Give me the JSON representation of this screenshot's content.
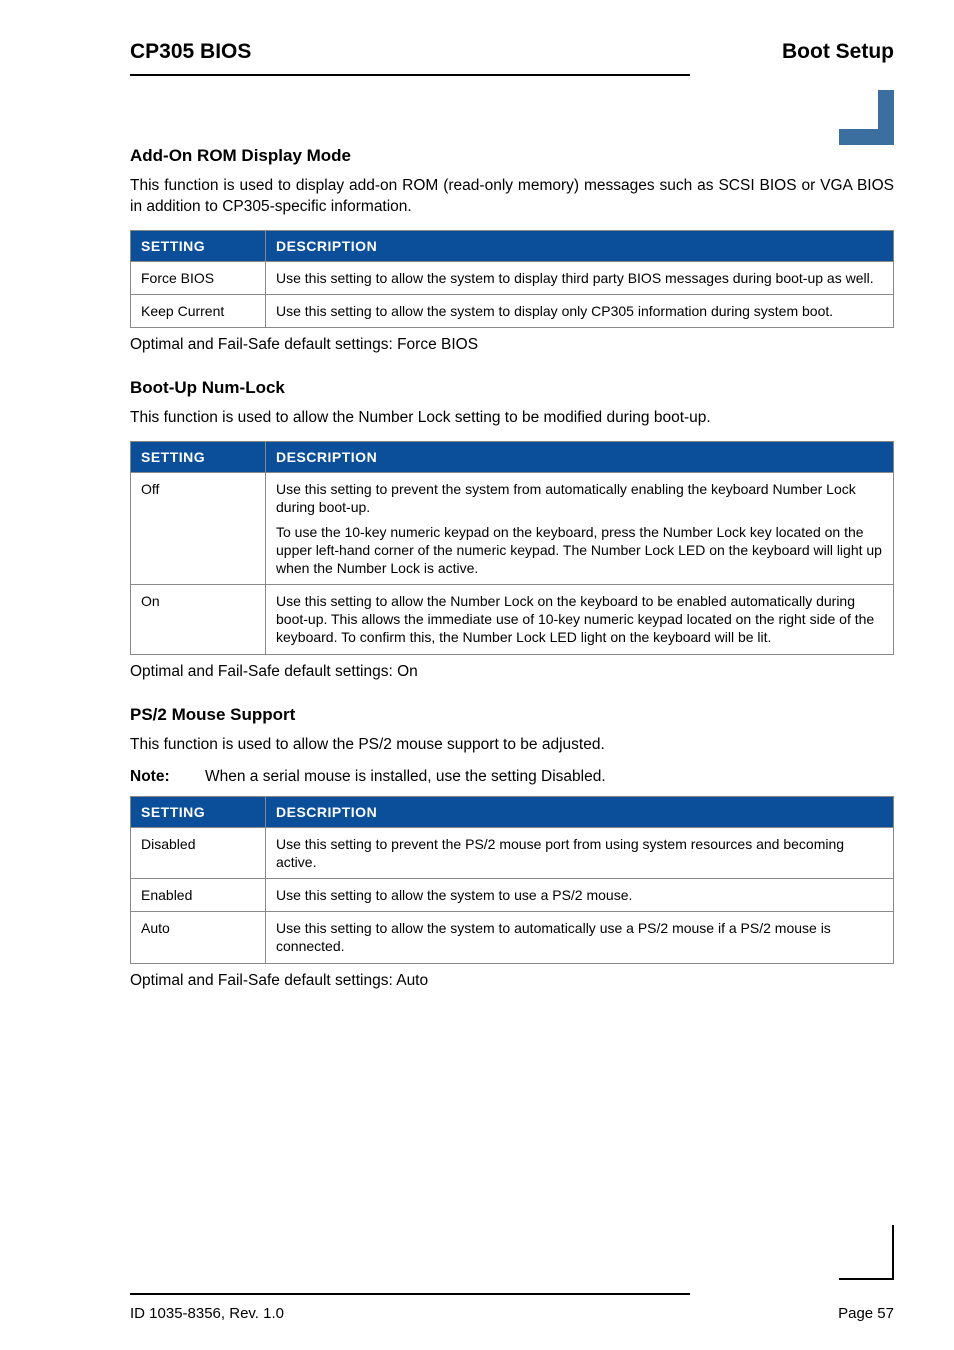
{
  "header": {
    "left": "CP305 BIOS",
    "right": "Boot Setup"
  },
  "sections": [
    {
      "title": "Add-On ROM Display Mode",
      "intro": "This function is used to display add-on ROM (read-only memory) messages such as SCSI BIOS or VGA BIOS in addition to CP305-specific information.",
      "th1": "SETTING",
      "th2": "DESCRIPTION",
      "rows": [
        {
          "setting": "Force BIOS",
          "desc": [
            "Use this setting to allow the system to display third party BIOS messages during boot-up as well."
          ]
        },
        {
          "setting": "Keep Current",
          "desc": [
            "Use this setting to allow the system to display only CP305 information during system boot."
          ]
        }
      ],
      "default": "Optimal and Fail-Safe default settings: Force BIOS"
    },
    {
      "title": "Boot-Up Num-Lock",
      "intro": "This function is used to allow the Number Lock setting to be modified during boot-up.",
      "th1": "SETTING",
      "th2": "DESCRIPTION",
      "rows": [
        {
          "setting": "Off",
          "desc": [
            "Use this setting to prevent the system from automatically enabling the keyboard Number Lock during boot-up.",
            "To use the 10-key numeric keypad on the keyboard, press the Number Lock key located on the upper left-hand corner of the numeric keypad. The Number Lock LED on the keyboard will light up when the Number Lock is active."
          ]
        },
        {
          "setting": "On",
          "desc": [
            "Use this setting to allow the Number Lock on the keyboard to be enabled automatically during boot-up. This allows the immediate use of 10-key numeric keypad located on the right side of the keyboard. To confirm this, the Number Lock LED light on the keyboard will be lit."
          ]
        }
      ],
      "default": "Optimal and Fail-Safe default settings: On"
    },
    {
      "title": "PS/2 Mouse Support",
      "intro": "This function is used to allow the PS/2 mouse support to be adjusted.",
      "note": {
        "label": "Note:",
        "text": "When a serial mouse is installed, use the setting Disabled."
      },
      "th1": "SETTING",
      "th2": "DESCRIPTION",
      "rows": [
        {
          "setting": "Disabled",
          "desc": [
            "Use this setting to prevent the PS/2 mouse port from using system resources and becoming active."
          ]
        },
        {
          "setting": "Enabled",
          "desc": [
            "Use this setting to allow the system to use a PS/2 mouse."
          ]
        },
        {
          "setting": "Auto",
          "desc": [
            "Use this setting to allow the system to automatically use a PS/2 mouse if a PS/2 mouse is connected."
          ]
        }
      ],
      "default": "Optimal and Fail-Safe default settings: Auto"
    }
  ],
  "footer": {
    "left": "ID 1035-8356, Rev. 1.0",
    "right": "Page 57"
  }
}
